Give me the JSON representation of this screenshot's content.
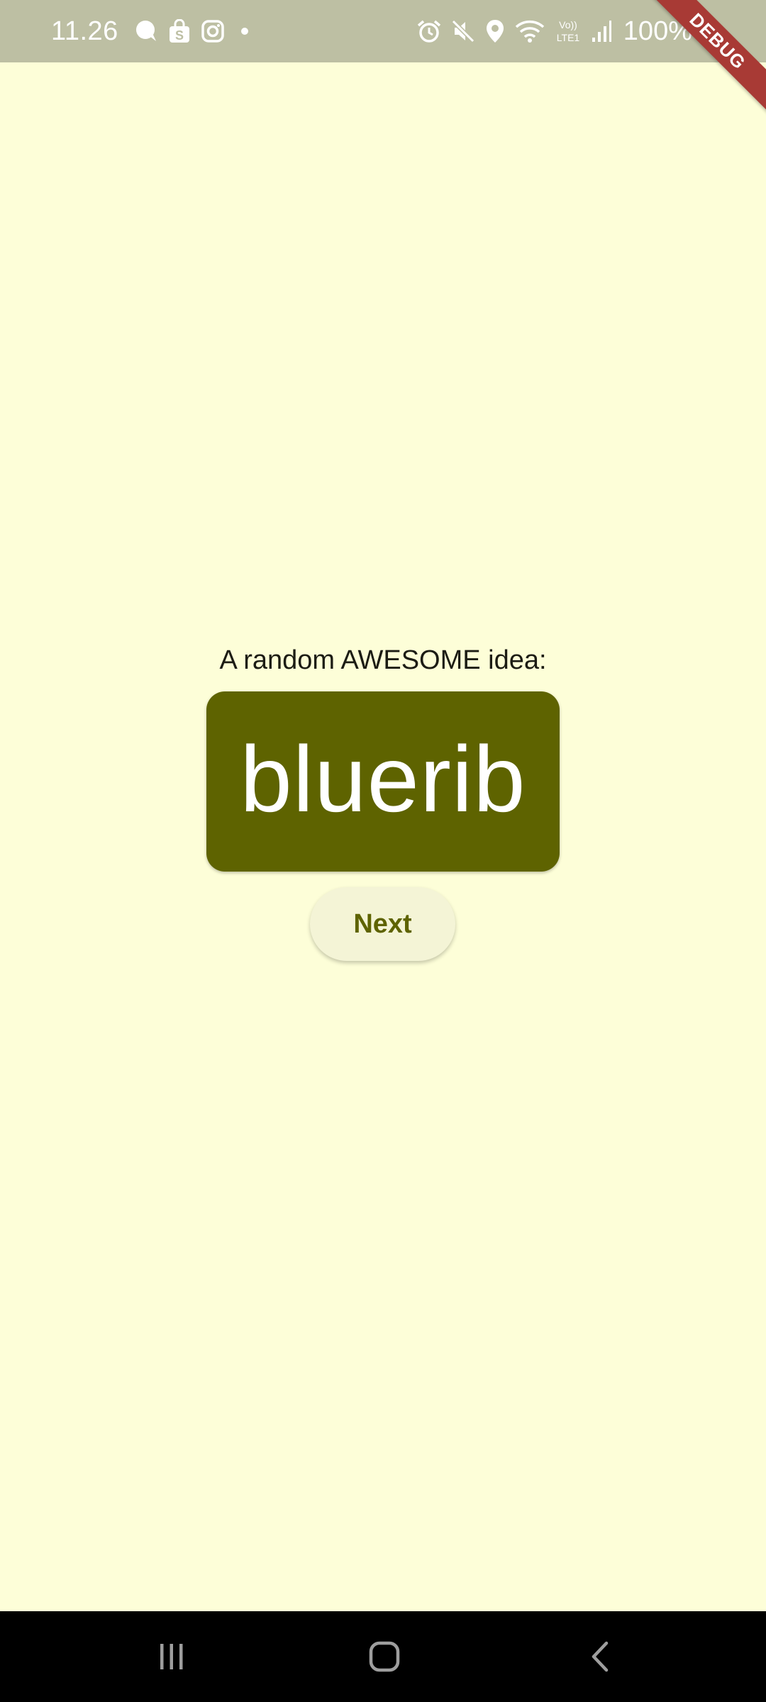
{
  "status_bar": {
    "time": "11.26",
    "battery_percent": "100%",
    "left_icons": [
      "chat-bubble-icon",
      "shopping-bag-icon",
      "instagram-icon",
      "notification-dot-icon"
    ],
    "right_icons": [
      "alarm-icon",
      "mute-icon",
      "location-icon",
      "wifi-icon",
      "volte-lte-icon",
      "signal-icon",
      "battery-charging-icon"
    ]
  },
  "debug_banner": {
    "label": "DEBUG"
  },
  "main": {
    "prompt": "A random AWESOME idea:",
    "idea": "bluerib",
    "next_label": "Next"
  },
  "nav_bar": {
    "icons": [
      "recent-apps-icon",
      "home-icon",
      "back-icon"
    ]
  },
  "colors": {
    "background": "#fdfed8",
    "status_bar": "#bdbfa3",
    "card": "#5e6300",
    "button_bg": "#f4f4d6",
    "button_text": "#5e6300",
    "debug_banner": "#a83a35"
  }
}
